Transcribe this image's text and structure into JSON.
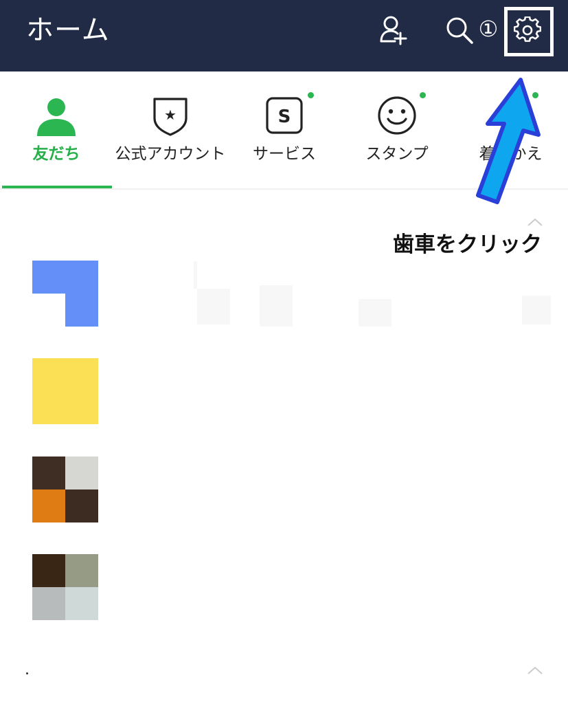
{
  "header": {
    "title": "ホーム",
    "step_number": "①"
  },
  "tabs": [
    {
      "label": "友だち",
      "icon": "person-icon",
      "active": true
    },
    {
      "label": "公式アカウント",
      "icon": "official-badge-icon",
      "active": false
    },
    {
      "label": "サービス",
      "icon": "service-s-icon",
      "active": false,
      "dot": true
    },
    {
      "label": "スタンプ",
      "icon": "smiley-icon",
      "active": false,
      "dot": true
    },
    {
      "label": "着せかえ",
      "icon": "theme-icon",
      "active": false,
      "dot": true
    }
  ],
  "annotation": {
    "text": "歯車をクリック"
  },
  "colors": {
    "header_bg": "#222b45",
    "accent_green": "#2bb651",
    "arrow_fill": "#0fa6f0",
    "arrow_stroke": "#2a3fd8"
  }
}
